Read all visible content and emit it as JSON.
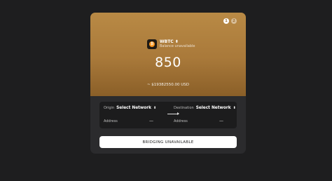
{
  "steps": [
    "1",
    "2"
  ],
  "token": {
    "symbol": "WBTC",
    "caret": "⬍",
    "icon_glyph": "₿",
    "balance_text": "Balance unavailable"
  },
  "amount": "850",
  "usd_value": "~ $19382550.00 USD",
  "origin": {
    "label": "Origin",
    "value": "Select Network",
    "address_label": "Address",
    "address_value": "—"
  },
  "destination": {
    "label": "Destination",
    "value": "Select Network",
    "address_label": "Address",
    "address_value": "—"
  },
  "action_button": "BRIDGING UNAVAILABLE",
  "colors": {
    "background": "#1e1e1f",
    "card": "#2b2b2d",
    "hero_gold": "#a9793a",
    "panel": "#1c1c1d",
    "button": "#ffffff"
  }
}
